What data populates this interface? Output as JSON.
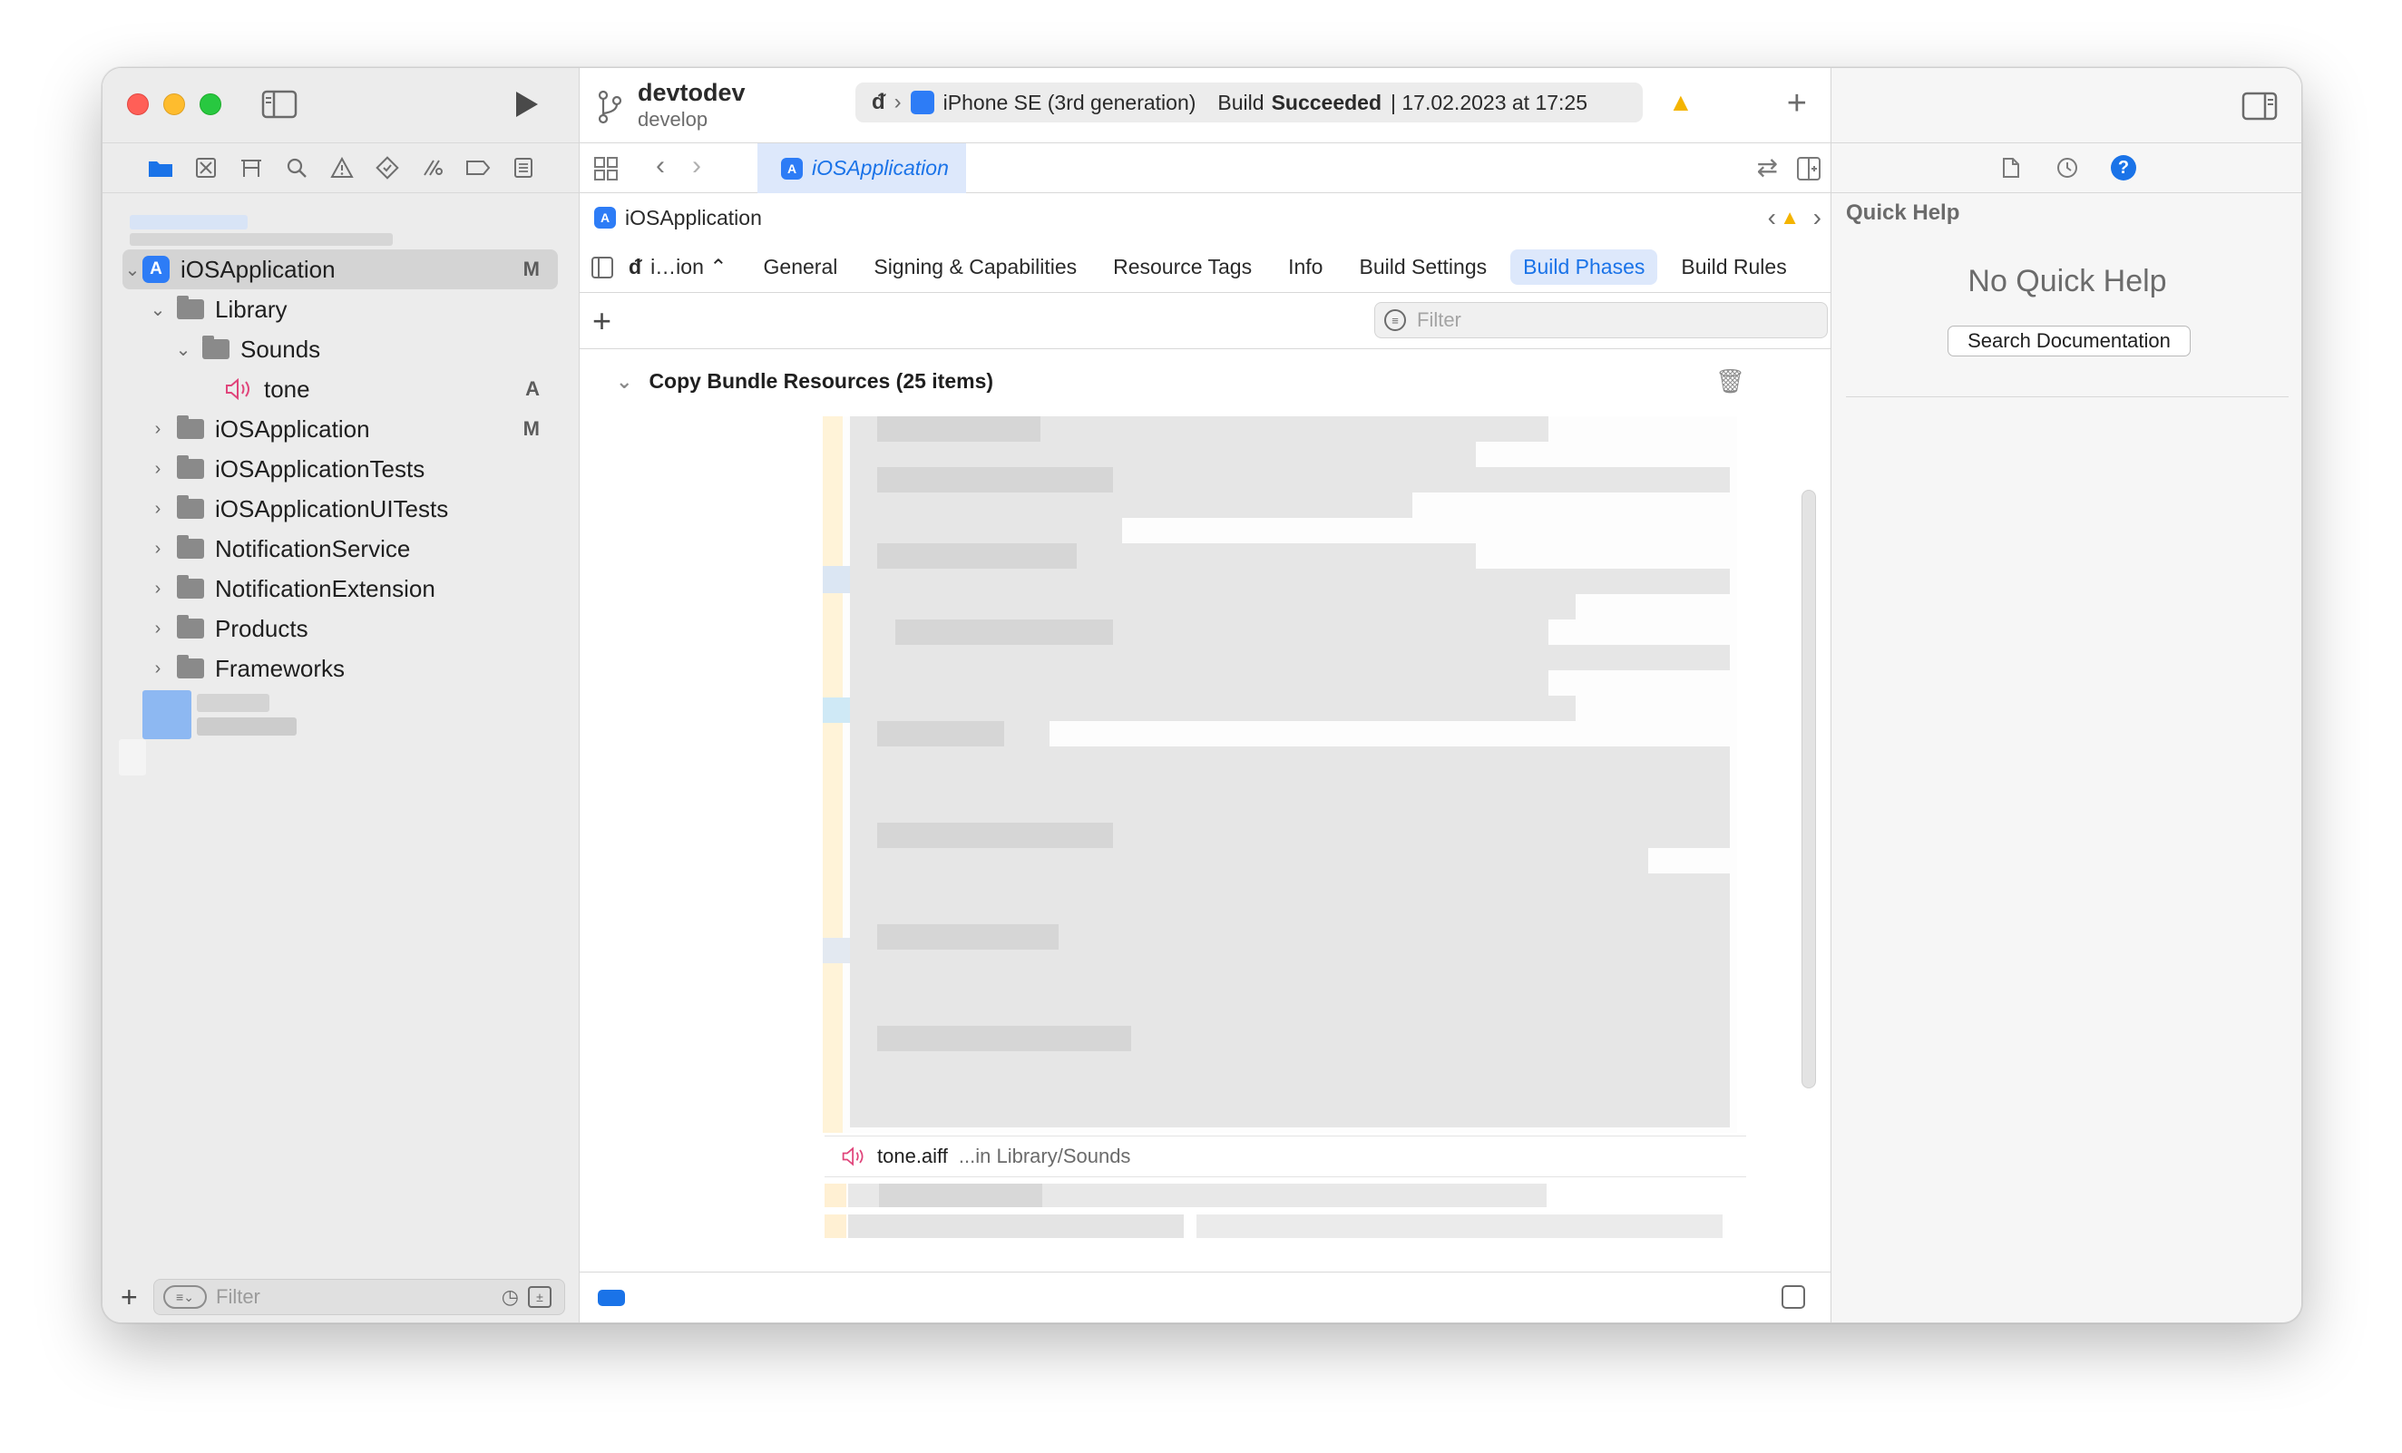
{
  "toolbar": {
    "project_name": "devtodev",
    "branch_name": "develop",
    "device": "iPhone SE (3rd generation)",
    "build_prefix": "Build",
    "build_status": "Succeeded",
    "build_time": "| 17.02.2023 at 17:25"
  },
  "editor_tab": {
    "label": "iOSApplication"
  },
  "breadcrumb": {
    "label": "iOSApplication"
  },
  "settings_tabs": {
    "target": "i…ion ⌃",
    "items": [
      "General",
      "Signing & Capabilities",
      "Resource Tags",
      "Info",
      "Build Settings",
      "Build Phases",
      "Build Rules"
    ],
    "active": "Build Phases"
  },
  "phase": {
    "filter_placeholder": "Filter",
    "title": "Copy Bundle Resources (25 items)",
    "highlight_file": "tone.aiff",
    "highlight_path": "...in Library/Sounds"
  },
  "sidebar": {
    "filter_placeholder": "Filter",
    "tree": [
      {
        "label": "iOSApplication",
        "badge": "M"
      },
      {
        "label": "Library",
        "badge": ""
      },
      {
        "label": "Sounds",
        "badge": ""
      },
      {
        "label": "tone",
        "badge": "A"
      },
      {
        "label": "iOSApplication",
        "badge": "M"
      },
      {
        "label": "iOSApplicationTests",
        "badge": ""
      },
      {
        "label": "iOSApplicationUITests",
        "badge": ""
      },
      {
        "label": "NotificationService",
        "badge": ""
      },
      {
        "label": "NotificationExtension",
        "badge": ""
      },
      {
        "label": "Products",
        "badge": ""
      },
      {
        "label": "Frameworks",
        "badge": ""
      }
    ]
  },
  "inspector": {
    "title": "Quick Help",
    "empty": "No Quick Help",
    "search_button": "Search Documentation"
  },
  "colors": {
    "accent": "#1a73e8",
    "warning": "#f4b400",
    "audio_icon": "#e0457b"
  }
}
